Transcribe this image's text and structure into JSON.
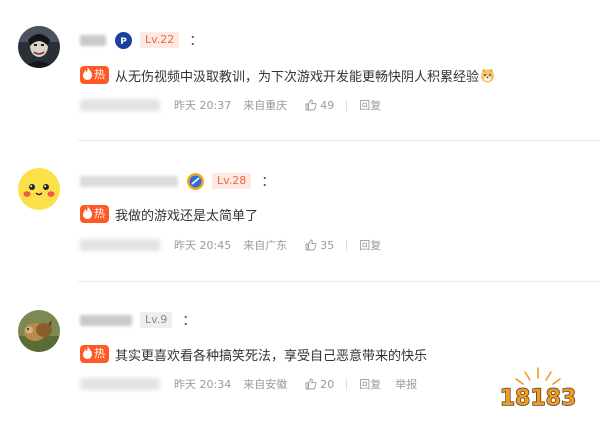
{
  "comments": [
    {
      "badge": "Lv.22",
      "colon": "：",
      "hot_label": "热",
      "text": "从无伤视频中汲取教训，为下次游戏开发能更畅快阴人积累经验",
      "time": "昨天 20:37",
      "location": "来自重庆",
      "likes": "49",
      "reply": "回复"
    },
    {
      "badge": "Lv.28",
      "colon": "：",
      "hot_label": "热",
      "text": "我做的游戏还是太简单了",
      "time": "昨天 20:45",
      "location": "来自广东",
      "likes": "35",
      "reply": "回复"
    },
    {
      "badge": "Lv.9",
      "colon": "：",
      "hot_label": "热",
      "text": "其实更喜欢看各种搞笑死法，享受自己恶意带来的快乐",
      "time": "昨天 20:34",
      "location": "来自安徽",
      "likes": "20",
      "reply": "回复",
      "report": "举报"
    }
  ],
  "watermark": "18183",
  "colors": {
    "hot": "#ff5a26",
    "badge_orange_bg": "#fde8e2",
    "badge_orange_text": "#f0663f",
    "meta_text": "#9a9a9a",
    "logo_orange": "#f39a1e"
  }
}
